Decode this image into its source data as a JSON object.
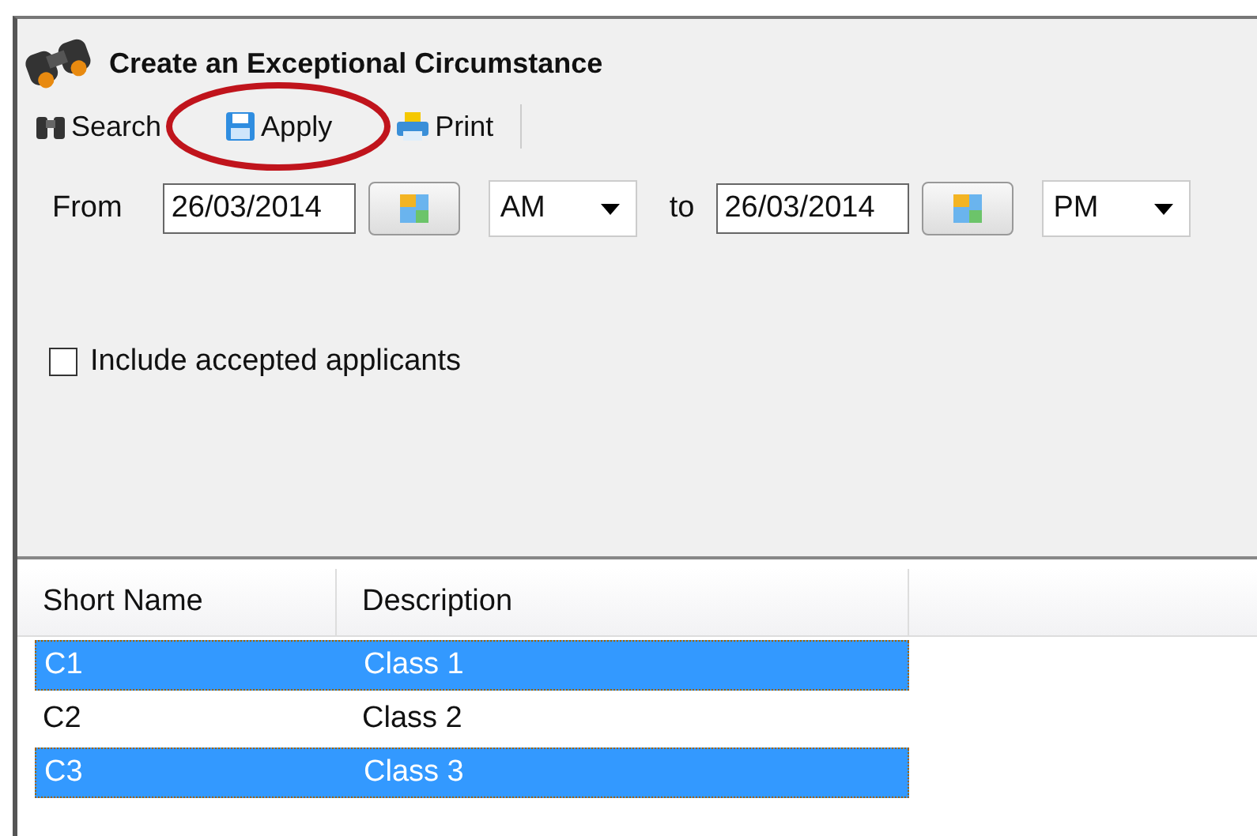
{
  "window": {
    "title": "Create an Exceptional Circumstance"
  },
  "toolbar": [
    {
      "label": "Search",
      "kind": "search"
    },
    {
      "label": "Apply",
      "kind": "save"
    },
    {
      "label": "Print",
      "kind": "print"
    }
  ],
  "annotation": {
    "kind": "ellipse",
    "color": "#c0141c"
  },
  "date_range": {
    "from_label": "From",
    "from_date": "26/03/2014",
    "from_period": "AM",
    "to_label": "to",
    "to_date": "26/03/2014",
    "to_period": "PM"
  },
  "include_accepted": {
    "label": "Include accepted applicants",
    "checked": false
  },
  "table": {
    "columns": [
      "Short Name",
      "Description"
    ],
    "rows": [
      {
        "cells": [
          "C1",
          "Class 1"
        ],
        "selected": true
      },
      {
        "cells": [
          "C2",
          "Class 2"
        ],
        "selected": false
      },
      {
        "cells": [
          "C3",
          "Class 3"
        ],
        "selected": true
      }
    ]
  }
}
